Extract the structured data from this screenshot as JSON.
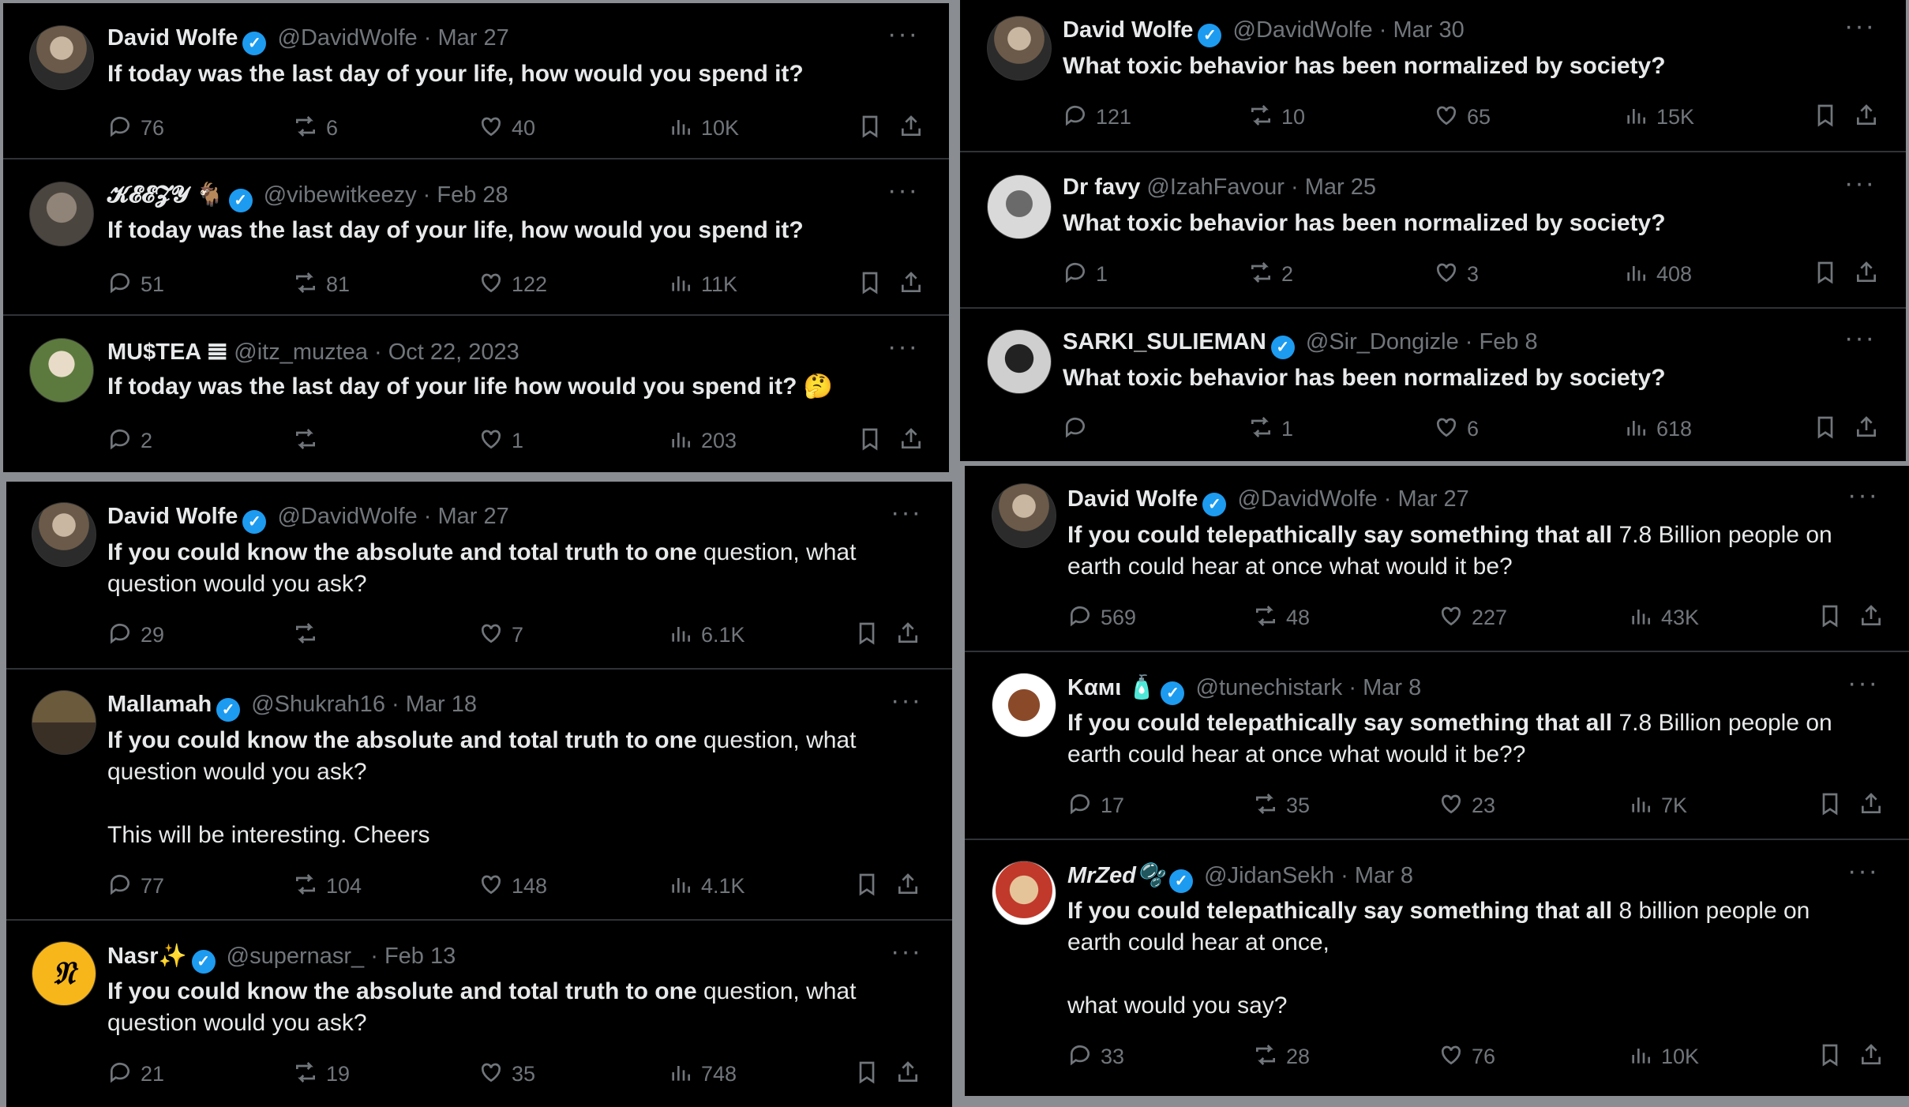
{
  "panels": [
    {
      "tweets": [
        {
          "name": "David Wolfe",
          "verified": true,
          "handle": "@DavidWolfe",
          "date": "Mar 27",
          "text_bold": "If today was the last day of your life, how would you spend it?",
          "text_rest": "",
          "extra": "",
          "replies": "76",
          "reposts": "6",
          "likes": "40",
          "views": "10K"
        },
        {
          "name": "𝓚𝓔𝓔𝓩𝓨 🐐",
          "verified": true,
          "handle": "@vibewitkeezy",
          "date": "Feb 28",
          "text_bold": "If today was the last day of your life, how would you spend it?",
          "text_rest": "",
          "extra": "",
          "replies": "51",
          "reposts": "81",
          "likes": "122",
          "views": "11K"
        },
        {
          "name": "MU$TEA 𝌆",
          "verified": false,
          "handle": "@itz_muztea",
          "date": "Oct 22, 2023",
          "text_bold": "If today was the last day of your life how would you spend it? 🤔",
          "text_rest": "",
          "extra": "",
          "replies": "2",
          "reposts": "",
          "likes": "1",
          "views": "203"
        }
      ]
    },
    {
      "tweets": [
        {
          "name": "David Wolfe",
          "verified": true,
          "handle": "@DavidWolfe",
          "date": "Mar 30",
          "text_bold": "What toxic behavior has been normalized by society?",
          "text_rest": "",
          "extra": "",
          "replies": "121",
          "reposts": "10",
          "likes": "65",
          "views": "15K"
        },
        {
          "name": "Dr favy",
          "verified": false,
          "handle": "@IzahFavour",
          "date": "Mar 25",
          "text_bold": "What toxic behavior has been normalized by society?",
          "text_rest": "",
          "extra": "",
          "replies": "1",
          "reposts": "2",
          "likes": "3",
          "views": "408"
        },
        {
          "name": "SARKI_SULIEMAN",
          "verified": true,
          "handle": "@Sir_Dongizle",
          "date": "Feb 8",
          "text_bold": "What toxic behavior has been normalized by society?",
          "text_rest": "",
          "extra": "",
          "replies": "",
          "reposts": "1",
          "likes": "6",
          "views": "618"
        }
      ]
    },
    {
      "tweets": [
        {
          "name": "David Wolfe",
          "verified": true,
          "handle": "@DavidWolfe",
          "date": "Mar 27",
          "text_bold": "If you could know the absolute and total truth to one",
          "text_rest": " question, what question would you ask?",
          "extra": "",
          "replies": "29",
          "reposts": "",
          "likes": "7",
          "views": "6.1K"
        },
        {
          "name": "Mallamah",
          "verified": true,
          "handle": "@Shukrah16",
          "date": "Mar 18",
          "text_bold": "If you could know the absolute and total truth to one",
          "text_rest": " question, what question would you ask?",
          "extra": "This will be interesting. Cheers",
          "replies": "77",
          "reposts": "104",
          "likes": "148",
          "views": "4.1K"
        },
        {
          "name": "Nasr✨",
          "verified": true,
          "handle": "@supernasr_",
          "date": "Feb 13",
          "avatar_letter": "𝔑",
          "text_bold": "If you could know the absolute and total truth to one",
          "text_rest": " question, what question would you ask?",
          "extra": "",
          "replies": "21",
          "reposts": "19",
          "likes": "35",
          "views": "748"
        }
      ]
    },
    {
      "tweets": [
        {
          "name": "David Wolfe",
          "verified": true,
          "handle": "@DavidWolfe",
          "date": "Mar 27",
          "text_bold": "If you could telepathically say something that all",
          "text_rest": " 7.8 Billion people on earth could hear at once what would it be?",
          "extra": "",
          "replies": "569",
          "reposts": "48",
          "likes": "227",
          "views": "43K"
        },
        {
          "name": "Kαмι 🧴",
          "verified": true,
          "handle": "@tunechistark",
          "date": "Mar 8",
          "text_bold": "If you could telepathically say something that all",
          "text_rest": " 7.8 Billion people on earth could hear at once what would it be??",
          "extra": "",
          "replies": "17",
          "reposts": "35",
          "likes": "23",
          "views": "7K"
        },
        {
          "name": "MrZed🫧",
          "verified": true,
          "handle": "@JidanSekh",
          "date": "Mar 8",
          "text_bold": "If you could telepathically say something that all",
          "text_rest": " 8 billion people on earth could hear at once,",
          "extra": "what would you say?",
          "replies": "33",
          "reposts": "28",
          "likes": "76",
          "views": "10K"
        }
      ]
    }
  ]
}
